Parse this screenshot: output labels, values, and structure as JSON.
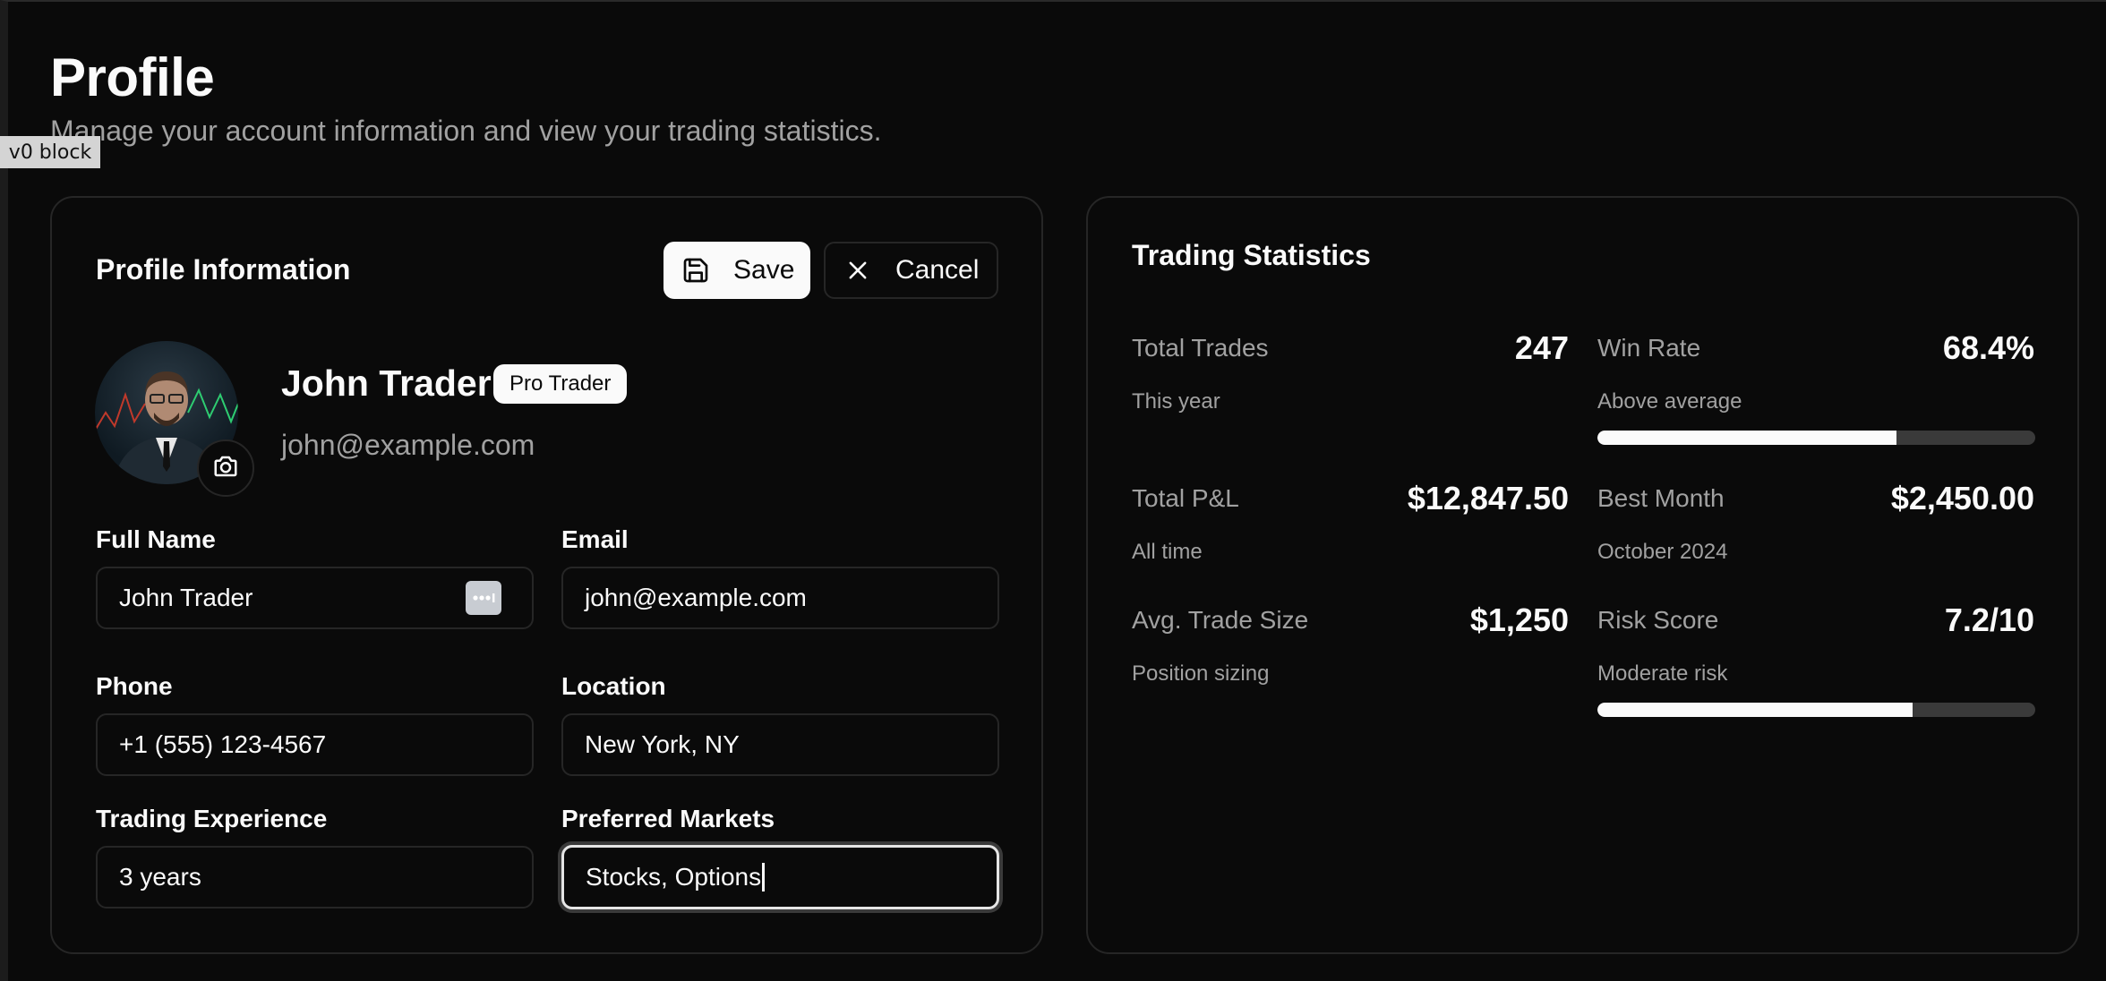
{
  "badge_label": "v0 block",
  "page": {
    "title": "Profile",
    "subtitle": "Manage your account information and view your trading statistics."
  },
  "profile_card": {
    "title": "Profile Information",
    "save_label": "Save",
    "cancel_label": "Cancel",
    "user_name": "John Trader",
    "user_badge": "Pro Trader",
    "user_email": "john@example.com",
    "fields": {
      "full_name": {
        "label": "Full Name",
        "value": "John Trader"
      },
      "email": {
        "label": "Email",
        "value": "john@example.com"
      },
      "phone": {
        "label": "Phone",
        "value": "+1 (555) 123-4567"
      },
      "location": {
        "label": "Location",
        "value": "New York, NY"
      },
      "experience": {
        "label": "Trading Experience",
        "value": "3 years"
      },
      "markets": {
        "label": "Preferred Markets",
        "value": "Stocks, Options"
      }
    }
  },
  "stats_card": {
    "title": "Trading Statistics",
    "total_trades": {
      "label": "Total Trades",
      "value": "247",
      "sub": "This year"
    },
    "win_rate": {
      "label": "Win Rate",
      "value": "68.4%",
      "sub": "Above average",
      "progress": 0.684
    },
    "total_pnl": {
      "label": "Total P&L",
      "value": "$12,847.50",
      "sub": "All time"
    },
    "best_month": {
      "label": "Best Month",
      "value": "$2,450.00",
      "sub": "October 2024"
    },
    "avg_trade": {
      "label": "Avg. Trade Size",
      "value": "$1,250",
      "sub": "Position sizing"
    },
    "risk_score": {
      "label": "Risk Score",
      "value": "7.2/10",
      "sub": "Moderate risk",
      "progress": 0.72
    }
  },
  "colors": {
    "background": "#0a0a0a",
    "border": "#262626",
    "foreground": "#fafafa",
    "muted": "#a1a1a1",
    "progress_track": "#3a3a3a"
  }
}
